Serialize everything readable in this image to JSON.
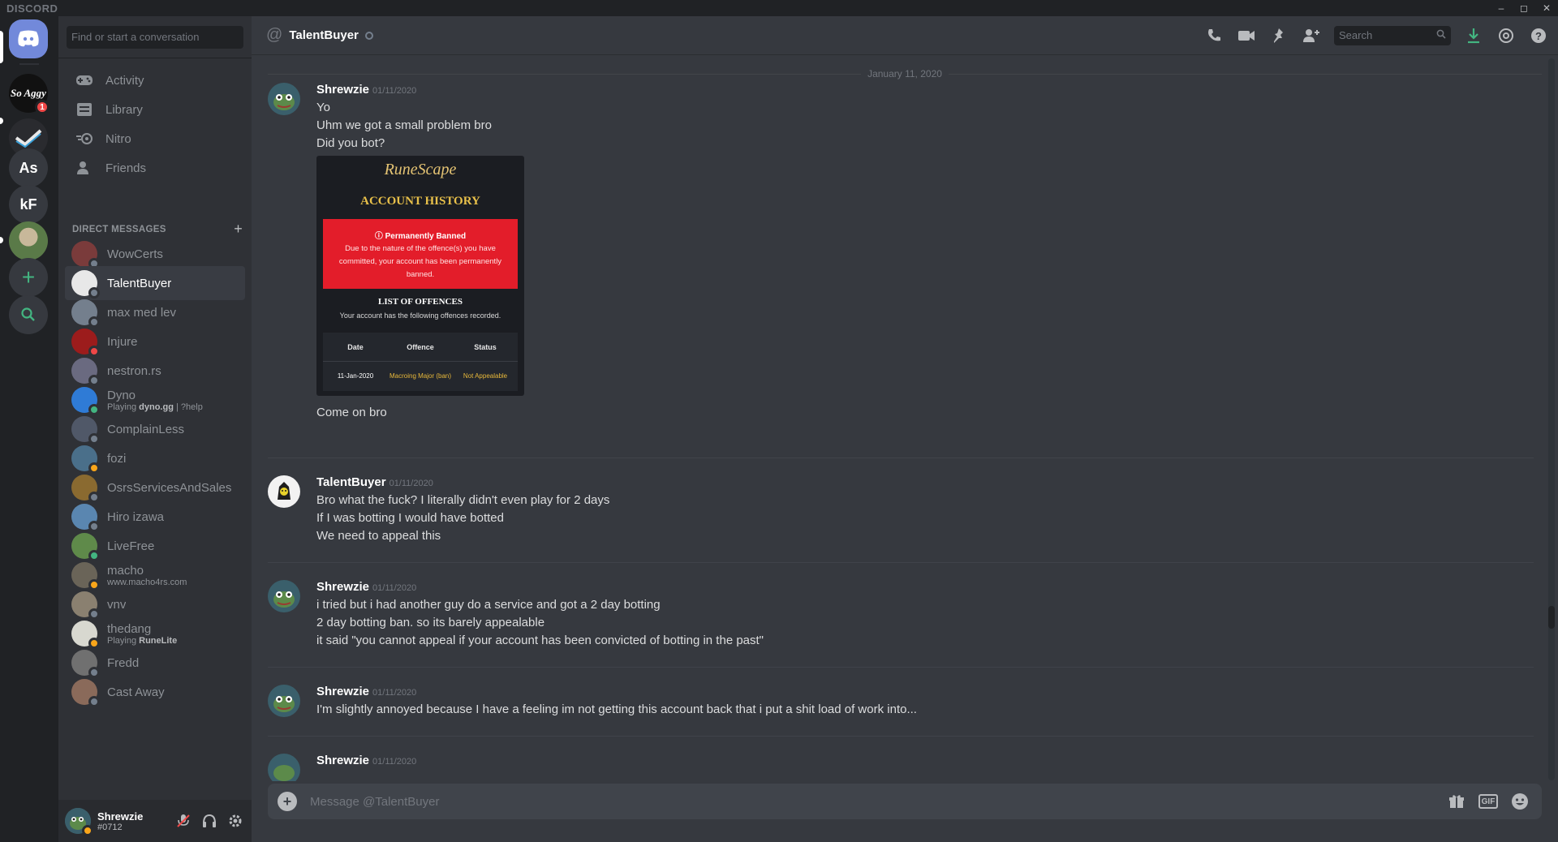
{
  "app": {
    "brand": "DISCORD"
  },
  "window_controls": [
    "minimize",
    "maximize",
    "close"
  ],
  "servers": [
    {
      "name": "home",
      "icon": "discord-icon"
    },
    {
      "name": "server-sofaggy",
      "label": "So Aggy",
      "badge": "1",
      "color": "#111111"
    },
    {
      "name": "server-check",
      "label": "",
      "color": "#2a2b2f"
    },
    {
      "name": "server-as",
      "label": "As",
      "color": "#36393f"
    },
    {
      "name": "server-kf",
      "label": "kF",
      "color": "#36393f"
    },
    {
      "name": "server-photo",
      "label": "",
      "color": "#5a7a48"
    },
    {
      "name": "add-server",
      "label": "+"
    },
    {
      "name": "explore",
      "label": ""
    }
  ],
  "sidebar": {
    "search_placeholder": "Find or start a conversation",
    "nav": [
      {
        "label": "Activity",
        "icon": "gamepad-icon"
      },
      {
        "label": "Library",
        "icon": "library-icon"
      },
      {
        "label": "Nitro",
        "icon": "nitro-icon"
      },
      {
        "label": "Friends",
        "icon": "friends-icon"
      }
    ],
    "dm_header": "DIRECT MESSAGES",
    "dms": [
      {
        "name": "WowCerts",
        "status": "offline",
        "color": "#7a3b3b"
      },
      {
        "name": "TalentBuyer",
        "status": "offline",
        "color": "#e8e8e8",
        "active": true
      },
      {
        "name": "max med lev",
        "status": "offline",
        "color": "#747f8d"
      },
      {
        "name": "Injure",
        "status": "dnd",
        "color": "#9c1c1c"
      },
      {
        "name": "nestron.rs",
        "status": "offline",
        "color": "#6a6a80"
      },
      {
        "name": "Dyno",
        "status": "online",
        "color": "#2f7bd6",
        "activity_prefix": "Playing ",
        "activity_bold": "dyno.gg",
        "activity_suffix": " | ?help"
      },
      {
        "name": "ComplainLess",
        "status": "offline",
        "color": "#505868"
      },
      {
        "name": "fozi",
        "status": "idle",
        "color": "#4a6f8a"
      },
      {
        "name": "OsrsServicesAndSales",
        "status": "offline",
        "color": "#8a6a30"
      },
      {
        "name": "Hiro izawa",
        "status": "offline",
        "color": "#5a86b0"
      },
      {
        "name": "LiveFree",
        "status": "online",
        "color": "#5f8a4a"
      },
      {
        "name": "macho",
        "status": "idle",
        "color": "#6a6458",
        "activity_prefix": "",
        "activity_bold": "",
        "activity_suffix": "www.macho4rs.com"
      },
      {
        "name": "vnv",
        "status": "offline",
        "color": "#8a8070"
      },
      {
        "name": "thedang",
        "status": "idle",
        "color": "#d8d8d0",
        "activity_prefix": "Playing ",
        "activity_bold": "RuneLite",
        "activity_suffix": ""
      },
      {
        "name": "Fredd",
        "status": "offline",
        "color": "#707070"
      },
      {
        "name": "Cast Away",
        "status": "offline",
        "color": "#8a6a5a"
      }
    ]
  },
  "user_panel": {
    "username": "Shrewzie",
    "tag": "#0712"
  },
  "chat": {
    "title": "TalentBuyer",
    "search_placeholder": "Search",
    "date_divider": "January 11, 2020",
    "messages": [
      {
        "author": "Shrewzie",
        "timestamp": "01/11/2020",
        "lines": [
          "Yo",
          "Uhm we got a small problem bro",
          "Did you bot?"
        ],
        "has_image": true,
        "after_image": [
          "Come on bro"
        ]
      },
      {
        "author": "TalentBuyer",
        "timestamp": "01/11/2020",
        "lines": [
          "Bro what the fuck? I literally didn't even play for 2 days",
          "If I was botting I would have botted",
          "We need to appeal this"
        ]
      },
      {
        "author": "Shrewzie",
        "timestamp": "01/11/2020",
        "lines": [
          "i tried but i had another guy do a service and got a 2 day botting",
          "2 day botting ban. so its barely appealable",
          "it said \"you cannot appeal if your account has been convicted of botting in the past\""
        ]
      },
      {
        "author": "Shrewzie",
        "timestamp": "01/11/2020",
        "lines": [
          "I'm slightly annoyed because I have a feeling im not getting this account back that i put a shit load of work into..."
        ]
      },
      {
        "author": "Shrewzie",
        "timestamp": "01/11/2020",
        "lines": []
      }
    ],
    "image": {
      "logo": "RuneScape",
      "title": "ACCOUNT HISTORY",
      "ban_title": "Permanently Banned",
      "ban_body": "Due to the nature of the offence(s) you have committed, your account has been permanently banned.",
      "offences_title": "LIST OF OFFENCES",
      "offences_sub": "Your account has the following offences recorded.",
      "col_date": "Date",
      "col_offence": "Offence",
      "col_status": "Status",
      "row_date": "11-Jan-2020",
      "row_offence": "Macroing Major (ban)",
      "row_status": "Not Appealable"
    },
    "composer_placeholder": "Message @TalentBuyer"
  }
}
